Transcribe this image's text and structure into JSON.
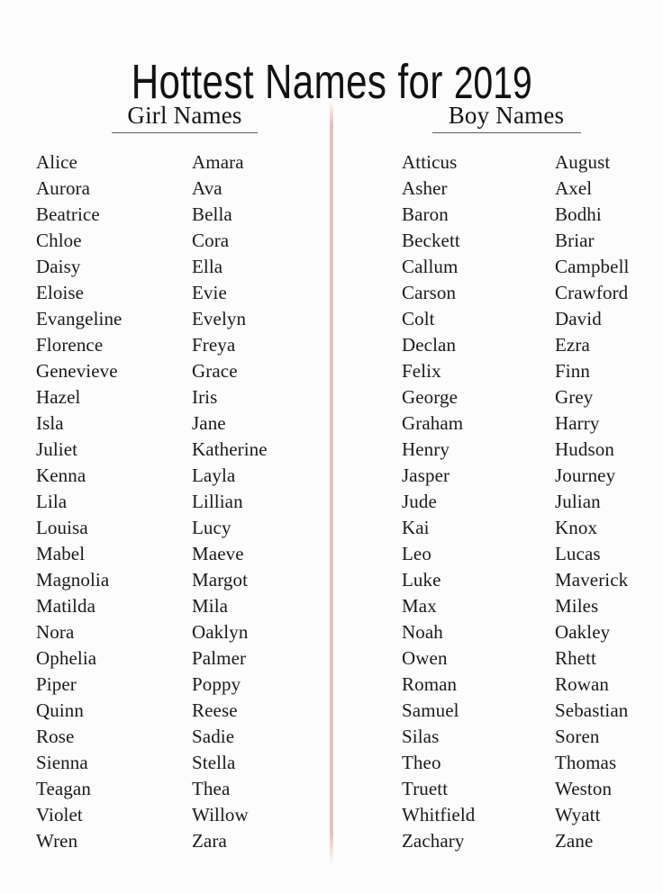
{
  "poster": {
    "title_main": "Hottest Names for",
    "title_year": "2019",
    "background_color": "#fdfcfc",
    "text_color": "#1a1a1a",
    "divider_color": "#e8bfc2",
    "rule_color": "#5d5d5d"
  },
  "sections": [
    {
      "id": "girls",
      "heading": "Girl Names",
      "columns": [
        {
          "id": "girls-column-1",
          "names": [
            "Alice",
            "Aurora",
            "Beatrice",
            "Chloe",
            "Daisy",
            "Eloise",
            "Evangeline",
            "Florence",
            "Genevieve",
            "Hazel",
            "Isla",
            "Juliet",
            "Kenna",
            "Lila",
            "Louisa",
            "Mabel",
            "Magnolia",
            "Matilda",
            "Nora",
            "Ophelia",
            "Piper",
            "Quinn",
            "Rose",
            "Sienna",
            "Teagan",
            "Violet",
            "Wren"
          ]
        },
        {
          "id": "girls-column-2",
          "names": [
            "Amara",
            "Ava",
            "Bella",
            "Cora",
            "Ella",
            "Evie",
            "Evelyn",
            "Freya",
            "Grace",
            "Iris",
            "Jane",
            "Katherine",
            "Layla",
            "Lillian",
            "Lucy",
            "Maeve",
            "Margot",
            "Mila",
            "Oaklyn",
            "Palmer",
            "Poppy",
            "Reese",
            "Sadie",
            "Stella",
            "Thea",
            "Willow",
            "Zara"
          ]
        }
      ]
    },
    {
      "id": "boys",
      "heading": "Boy Names",
      "columns": [
        {
          "id": "boys-column-1",
          "names": [
            "Atticus",
            "Asher",
            "Baron",
            "Beckett",
            "Callum",
            "Carson",
            "Colt",
            "Declan",
            "Felix",
            "George",
            "Graham",
            "Henry",
            "Jasper",
            "Jude",
            "Kai",
            "Leo",
            "Luke",
            "Max",
            "Noah",
            "Owen",
            "Roman",
            "Samuel",
            "Silas",
            "Theo",
            "Truett",
            "Whitfield",
            "Zachary"
          ]
        },
        {
          "id": "boys-column-2",
          "names": [
            "August",
            "Axel",
            "Bodhi",
            "Briar",
            "Campbell",
            "Crawford",
            "David",
            "Ezra",
            "Finn",
            "Grey",
            "Harry",
            "Hudson",
            "Journey",
            "Julian",
            "Knox",
            "Lucas",
            "Maverick",
            "Miles",
            "Oakley",
            "Rhett",
            "Rowan",
            "Sebastian",
            "Soren",
            "Thomas",
            "Weston",
            "Wyatt",
            "Zane"
          ]
        }
      ]
    }
  ]
}
